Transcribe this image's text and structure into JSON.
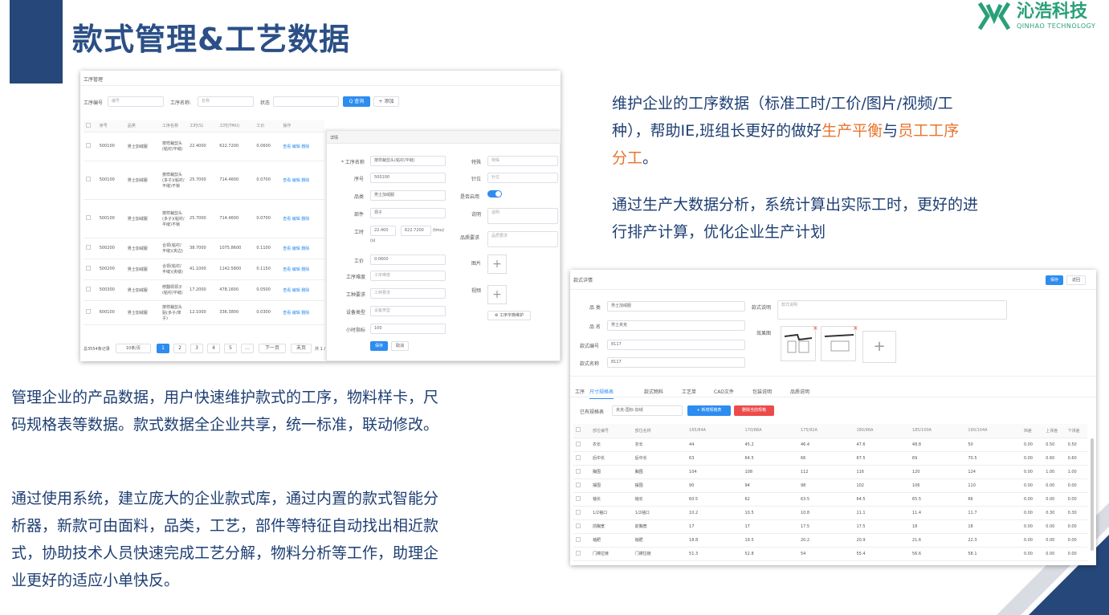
{
  "header": {
    "title": "款式管理&工艺数据",
    "logo_cn": "沁浩科技",
    "logo_en": "QINHAO TECHNOLOGY"
  },
  "texts": {
    "right_p1_a": "维护企业的工序数据（标准工时/工价/图片/视频/工",
    "right_p1_b": "种），帮助IE,班组长更好的做好",
    "right_p1_hl1": "生产平衡",
    "right_p1_mid": "与",
    "right_p1_hl2": "员工工序",
    "right_p1_c": "分工",
    "right_p1_end": "。",
    "right_p2_a": "通过生产大数据分析，系统计算出实际工时，更好的进",
    "right_p2_b": "行排产计算，优化企业生产计划",
    "left_p1_a": "管理企业的产品数据，用户快速维护款式的工序，物料样卡，尺",
    "left_p1_b": "码规格表等数据。款式数据全企业共享，统一标准，联动修改。",
    "left_p2_a": "通过使用系统，建立庞大的企业款式库，通过内置的款式智能分",
    "left_p2_b": "析器，新款可由面料，品类，工艺，部件等特征自动找出相近款",
    "left_p2_c": "式，协助技术人员快速完成工艺分解，物料分析等工作，助理企",
    "left_p2_d": "业更好的适应小单快反。"
  },
  "s1": {
    "title": "工序管理",
    "f_code": "工序编号",
    "f_code_ph": "编号",
    "f_name": "工序名称:",
    "f_name_ph": "名称",
    "f_status": "状态",
    "btn_query": "Q 查询",
    "btn_add": "+ 添加",
    "cols": [
      "序号",
      "品类",
      "工序名称",
      "工时(S)",
      "工时(TMU)",
      "工价",
      "操作"
    ],
    "rows": [
      {
        "no": "500100",
        "cat": "男士加绒服",
        "name": "按样裁剪头(粘衬/平缝)",
        "s": "22.4000",
        "tmu": "622.7200",
        "p": "0.0600"
      },
      {
        "no": "500100",
        "cat": "男士加绒服",
        "name": "按样裁剪头(多子)(粘衬/平缝)不锁",
        "s": "25.7000",
        "tmu": "714.4600",
        "p": "0.0700"
      },
      {
        "no": "500100",
        "cat": "男士加绒服",
        "name": "按样裁剪头(多子)(粘衬/平缝)不锁",
        "s": "25.7000",
        "tmu": "714.4600",
        "p": "0.0700"
      },
      {
        "no": "500200",
        "cat": "男士加绒服",
        "name": "合领(粘衬/平缝)(夹边)",
        "s": "38.7000",
        "tmu": "1075.8600",
        "p": "0.1100"
      },
      {
        "no": "500200",
        "cat": "男士加绒服",
        "name": "合领(粘衬/平缝)(夹缝)",
        "s": "41.1000",
        "tmu": "1142.5800",
        "p": "0.1150"
      },
      {
        "no": "500300",
        "cat": "男士加绒服",
        "name": "修翻领领子(粘衬/平缝)",
        "s": "17.2000",
        "tmu": "478.1600",
        "p": "0.0500"
      },
      {
        "no": "600100",
        "cat": "男士加绒服",
        "name": "按样裁剪头贴(多子/单子)",
        "s": "12.1000",
        "tmu": "336.3800",
        "p": "0.0300"
      }
    ],
    "acts": [
      "查看",
      "编辑",
      "删除"
    ],
    "total": "总3554条记录",
    "per_page": "10条/页",
    "pages": [
      "1",
      "2",
      "3",
      "4",
      "5",
      "...",
      "下一页",
      "末页",
      "共 1 /"
    ],
    "detail": {
      "title": "详情",
      "l_name": "* 工序名称",
      "v_name": "按样裁剪头(粘衬/平缝)",
      "l_seq": "序号",
      "v_seq": "500100",
      "l_cat": "品类",
      "v_cat": "男士加绒服",
      "l_part": "部件",
      "v_part": "领子",
      "l_time": "工时",
      "v_time1": "22.400",
      "v_time2": "622.7200",
      "u_tmu": "(tmu)",
      "u_s": "(s)",
      "l_price": "工价",
      "v_price": "0.0600",
      "l_diff": "工序难度",
      "ph_diff": "工序难度",
      "l_type": "工种要求",
      "ph_type": "工种要求",
      "l_equip": "设备类型",
      "ph_equip": "设备类型",
      "l_hour": "小时指标",
      "v_hour": "100",
      "l_feat": "特殊",
      "ph_feat": "特殊",
      "l_pos": "针位",
      "ph_pos": "针位",
      "l_enable": "是否启用",
      "l_desc": "说明",
      "ph_desc": "说明",
      "l_quality": "品质要求",
      "ph_quality": "品质要求",
      "l_img": "图片",
      "l_video": "视频",
      "btn_dict": "⚙ 工序字典维护",
      "btn_save": "保存",
      "btn_cancel": "取消"
    }
  },
  "s2": {
    "title": "款式详情",
    "btn_save": "保存",
    "btn_back": "返回",
    "l_cat": "品 类",
    "v_cat": "男士加绒服",
    "l_style": "款式说明",
    "ph_style": "款式说明",
    "l_name": "品 名",
    "v_name": "男士夹克",
    "l_effect": "效果图",
    "l_code": "款式编号",
    "v_code": "8117",
    "l_sname": "款式名称",
    "v_sname": "8117",
    "tabs": [
      "工序",
      "尺寸规格表",
      "款式物料",
      "工艺单",
      "CAD文件",
      "包装说明",
      "品质说明"
    ],
    "l_has": "已有规格表",
    "v_has": "夹克-国标-加绒",
    "btn_new": "+ 新增规格表",
    "btn_del": "删除当前规格",
    "cols": [
      "部位编号",
      "部位名称",
      "165/84A",
      "170/88A",
      "175/92A",
      "180/96A",
      "185/100A",
      "190/104A",
      "档差",
      "上误差",
      "下误差"
    ],
    "rows": [
      [
        "衣长",
        "衣长",
        "44",
        "45.2",
        "46.4",
        "47.6",
        "48.8",
        "50",
        "0.00",
        "0.50",
        "0.50"
      ],
      [
        "后中长",
        "后中长",
        "63",
        "64.5",
        "66",
        "67.5",
        "69",
        "70.5",
        "0.00",
        "0.60",
        "0.60"
      ],
      [
        "胸围",
        "胸围",
        "104",
        "108",
        "112",
        "116",
        "120",
        "124",
        "0.00",
        "1.00",
        "1.00"
      ],
      [
        "摆围",
        "摆围",
        "90",
        "94",
        "98",
        "102",
        "106",
        "110",
        "0.00",
        "0.00",
        "0.00"
      ],
      [
        "袖长",
        "袖长",
        "60.5",
        "62",
        "63.5",
        "64.5",
        "65.5",
        "66",
        "0.00",
        "0.00",
        "0.00"
      ],
      [
        "1/2袖口",
        "1/2袖口",
        "10.2",
        "10.5",
        "10.8",
        "11.1",
        "11.4",
        "11.7",
        "0.00",
        "0.30",
        "0.30"
      ],
      [
        "前胸宽",
        "前胸宽",
        "17",
        "17",
        "17.5",
        "17.5",
        "18",
        "18",
        "0.00",
        "0.00",
        "0.00"
      ],
      [
        "袖肥",
        "袖肥",
        "18.8",
        "19.5",
        "20.2",
        "20.9",
        "21.6",
        "22.3",
        "0.00",
        "0.00",
        "0.00"
      ],
      [
        "门襟拉链",
        "门襟拉链",
        "51.3",
        "52.8",
        "54",
        "55.4",
        "56.6",
        "58.1",
        "0.00",
        "0.00",
        "0.00"
      ]
    ]
  },
  "colors": {
    "navy": "#25477a",
    "title": "#2b4f86",
    "accent": "#e8742d",
    "green": "#2aa07a",
    "blue": "#2d8cf0"
  }
}
